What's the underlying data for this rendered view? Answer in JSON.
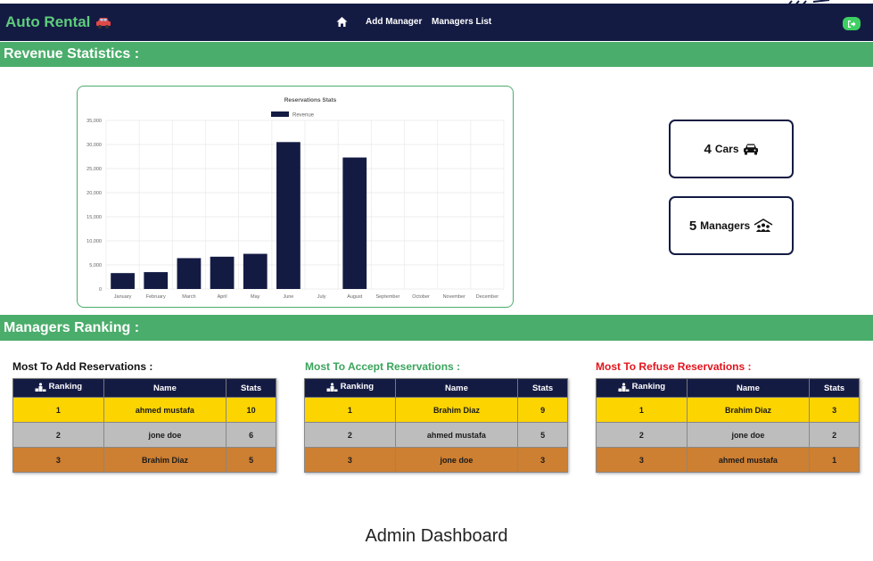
{
  "navbar": {
    "brand": "Auto Rental",
    "links": [
      "Add Manager",
      "Managers List"
    ]
  },
  "sections": {
    "revenue_title": "Revenue Statistics :",
    "ranking_title": "Managers Ranking :"
  },
  "cards": {
    "cars_count": "4",
    "cars_label": "Cars",
    "managers_count": "5",
    "managers_label": "Managers"
  },
  "chart_data": {
    "type": "bar",
    "title": "Reservations Stats",
    "categories": [
      "January",
      "February",
      "March",
      "April",
      "May",
      "June",
      "July",
      "August",
      "September",
      "October",
      "November",
      "December"
    ],
    "series": [
      {
        "name": "Revenue",
        "values": [
          3300,
          3500,
          6400,
          6700,
          7300,
          30500,
          0,
          27300,
          0,
          0,
          0,
          0
        ],
        "color": "#141b43"
      }
    ],
    "ylim": [
      0,
      35000
    ],
    "yticks": [
      0,
      5000,
      10000,
      15000,
      20000,
      25000,
      30000,
      35000
    ],
    "ytick_labels": [
      "0",
      "5,000",
      "10,000",
      "15,000",
      "20,000",
      "25,000",
      "30,000",
      "35,000"
    ],
    "grid": true,
    "legend": "top-center"
  },
  "rankings": {
    "headers": {
      "rank": "Ranking",
      "name": "Name",
      "stats": "Stats"
    },
    "add": {
      "title": "Most To Add Reservations :",
      "rows": [
        {
          "rank": "1",
          "name": "ahmed mustafa",
          "stats": "10"
        },
        {
          "rank": "2",
          "name": "jone doe",
          "stats": "6"
        },
        {
          "rank": "3",
          "name": "Brahim Diaz",
          "stats": "5"
        }
      ]
    },
    "accept": {
      "title": "Most To Accept Reservations :",
      "rows": [
        {
          "rank": "1",
          "name": "Brahim Diaz",
          "stats": "9"
        },
        {
          "rank": "2",
          "name": "ahmed mustafa",
          "stats": "5"
        },
        {
          "rank": "3",
          "name": "jone doe",
          "stats": "3"
        }
      ]
    },
    "refuse": {
      "title": "Most To Refuse Reservations :",
      "rows": [
        {
          "rank": "1",
          "name": "Brahim Diaz",
          "stats": "3"
        },
        {
          "rank": "2",
          "name": "jone doe",
          "stats": "2"
        },
        {
          "rank": "3",
          "name": "ahmed mustafa",
          "stats": "1"
        }
      ]
    }
  },
  "caption": "Admin Dashboard",
  "colors": {
    "navy": "#141b43",
    "green": "#4bad6b",
    "gold": "#fcd400",
    "silver": "#bdbdbd",
    "bronze": "#cd7f32"
  },
  "icons": [
    "car-icon",
    "home-icon",
    "logout-icon",
    "manager-group-icon",
    "podium-icon"
  ]
}
